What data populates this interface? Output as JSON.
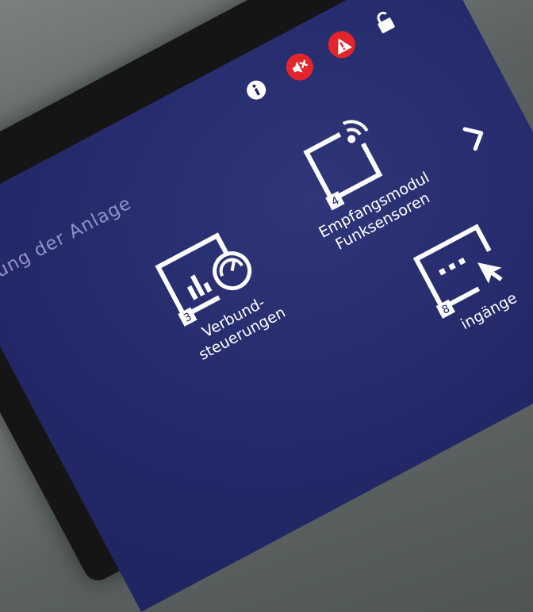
{
  "status_bar": {
    "icons": [
      "info-icon",
      "alarm-muted-icon",
      "warning-icon",
      "unlock-icon"
    ],
    "alert_color": "#e3252b"
  },
  "section": {
    "title": "ung der Anlage"
  },
  "tiles": [
    {
      "id": "verbund",
      "icon": "controller-dashboard-icon",
      "badge": "3",
      "label_line1": "Verbund-",
      "label_line2": "steuerungen"
    },
    {
      "id": "empfang",
      "icon": "wireless-module-icon",
      "badge": "4",
      "label_line1": "Empfangsmodul",
      "label_line2": "Funksensoren"
    },
    {
      "id": "eingaenge",
      "icon": "input-cursor-icon",
      "badge": "8",
      "label_line1": "ingänge"
    }
  ],
  "navigation": {
    "next_icon": "chevron-right-icon"
  },
  "colors": {
    "screen_background": "#232966",
    "title_text": "#8e93c8"
  }
}
